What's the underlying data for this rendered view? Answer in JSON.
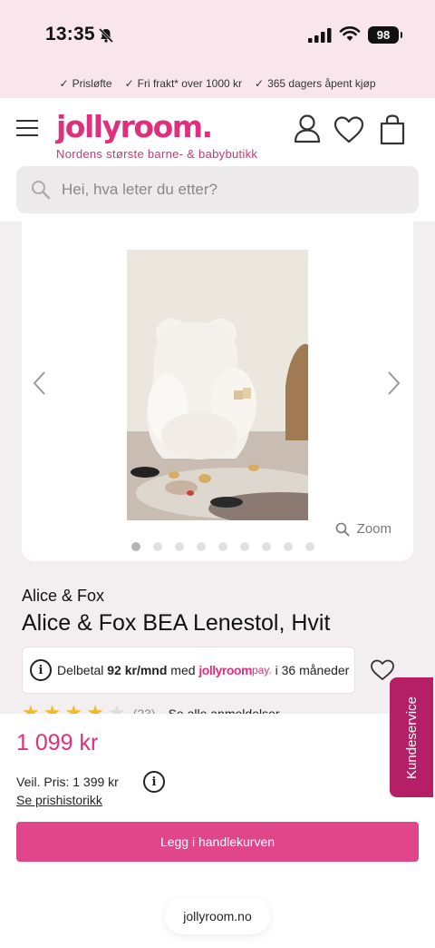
{
  "status": {
    "time": "13:35",
    "battery": "98"
  },
  "usps": [
    "Prisløfte",
    "Fri frakt* over 1000 kr",
    "365 dagers åpent kjøp"
  ],
  "header": {
    "logo": "jollyroom.",
    "tagline": "Nordens største barne- & babybutikk",
    "search_placeholder": "Hei, hva leter du etter?"
  },
  "gallery": {
    "zoom_label": "Zoom",
    "image_count": 9,
    "active_index": 0
  },
  "product": {
    "brand": "Alice & Fox",
    "title": "Alice & Fox BEA Lenestol, Hvit",
    "installment_prefix": "Delbetal",
    "installment_amount": "92 kr/mnd",
    "installment_mid": "med",
    "installment_logo": "jollyroom",
    "installment_logo_suffix": "pay.",
    "installment_suffix": "i 36 måneder",
    "rating_stars": 4,
    "review_count": "(23)",
    "reviews_link": "Se alle anmeldelser"
  },
  "purchase": {
    "price": "1 099 kr",
    "veil_price": "Veil. Pris: 1 399 kr",
    "price_history": "Se prishistorikk",
    "add_to_cart": "Legg i handlekurven"
  },
  "kundeservice": "Kundeservice",
  "url": "jollyroom.no",
  "colors": {
    "brand_pink": "#e0307d",
    "button_pink": "#e2468a",
    "service_tab": "#b51f66",
    "top_bar": "#f8e6ec"
  }
}
